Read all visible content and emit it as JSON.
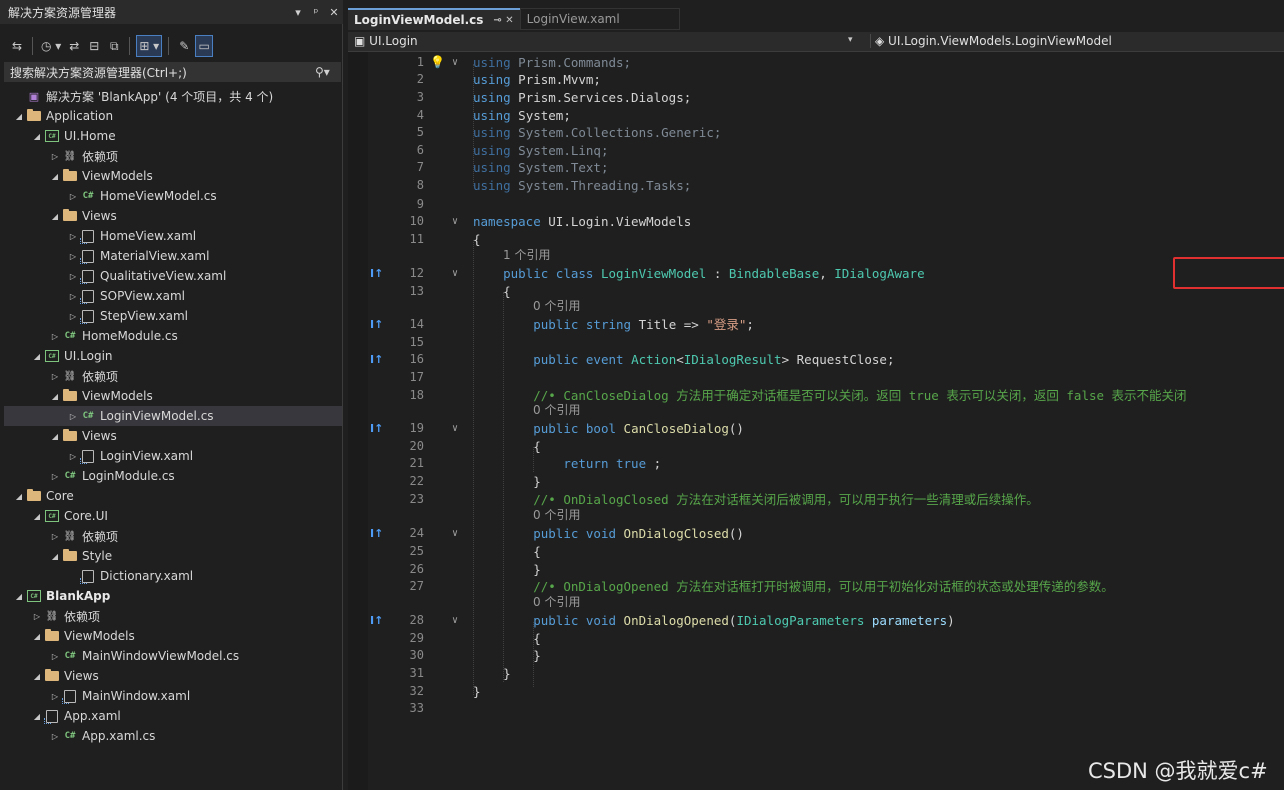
{
  "solution_explorer": {
    "title": "解决方案资源管理器",
    "title_buttons": [
      "▾",
      "ᵖ",
      "✕"
    ],
    "search_placeholder": "搜索解决方案资源管理器(Ctrl+;)",
    "tree": [
      {
        "indent": 0,
        "toggle": "",
        "icon": "sln",
        "label": "解决方案 'BlankApp' (4 个项目，共 4 个)"
      },
      {
        "indent": 0,
        "toggle": "◢",
        "icon": "folder",
        "label": "Application"
      },
      {
        "indent": 1,
        "toggle": "◢",
        "icon": "csproj",
        "label": "UI.Home"
      },
      {
        "indent": 2,
        "toggle": "▷",
        "icon": "dep",
        "label": "依赖项"
      },
      {
        "indent": 2,
        "toggle": "◢",
        "icon": "folder",
        "label": "ViewModels"
      },
      {
        "indent": 3,
        "toggle": "▷",
        "icon": "cs",
        "label": "HomeViewModel.cs"
      },
      {
        "indent": 2,
        "toggle": "◢",
        "icon": "folder",
        "label": "Views"
      },
      {
        "indent": 3,
        "toggle": "▷",
        "icon": "xaml",
        "label": "HomeView.xaml"
      },
      {
        "indent": 3,
        "toggle": "▷",
        "icon": "xaml",
        "label": "MaterialView.xaml"
      },
      {
        "indent": 3,
        "toggle": "▷",
        "icon": "xaml",
        "label": "QualitativeView.xaml"
      },
      {
        "indent": 3,
        "toggle": "▷",
        "icon": "xaml",
        "label": "SOPView.xaml"
      },
      {
        "indent": 3,
        "toggle": "▷",
        "icon": "xaml",
        "label": "StepView.xaml"
      },
      {
        "indent": 2,
        "toggle": "▷",
        "icon": "cs",
        "label": "HomeModule.cs"
      },
      {
        "indent": 1,
        "toggle": "◢",
        "icon": "csproj",
        "label": "UI.Login"
      },
      {
        "indent": 2,
        "toggle": "▷",
        "icon": "dep",
        "label": "依赖项"
      },
      {
        "indent": 2,
        "toggle": "◢",
        "icon": "folder",
        "label": "ViewModels"
      },
      {
        "indent": 3,
        "toggle": "▷",
        "icon": "cs",
        "label": "LoginViewModel.cs",
        "selected": true
      },
      {
        "indent": 2,
        "toggle": "◢",
        "icon": "folder",
        "label": "Views"
      },
      {
        "indent": 3,
        "toggle": "▷",
        "icon": "xaml",
        "label": "LoginView.xaml"
      },
      {
        "indent": 2,
        "toggle": "▷",
        "icon": "cs",
        "label": "LoginModule.cs"
      },
      {
        "indent": 0,
        "toggle": "◢",
        "icon": "folder",
        "label": "Core"
      },
      {
        "indent": 1,
        "toggle": "◢",
        "icon": "csproj",
        "label": "Core.UI"
      },
      {
        "indent": 2,
        "toggle": "▷",
        "icon": "dep",
        "label": "依赖项"
      },
      {
        "indent": 2,
        "toggle": "◢",
        "icon": "folder",
        "label": "Style"
      },
      {
        "indent": 3,
        "toggle": "",
        "icon": "xaml",
        "label": "Dictionary.xaml"
      },
      {
        "indent": 0,
        "toggle": "◢",
        "icon": "csproj",
        "label": "BlankApp",
        "bold": true
      },
      {
        "indent": 1,
        "toggle": "▷",
        "icon": "dep",
        "label": "依赖项"
      },
      {
        "indent": 1,
        "toggle": "◢",
        "icon": "folder",
        "label": "ViewModels"
      },
      {
        "indent": 2,
        "toggle": "▷",
        "icon": "cs",
        "label": "MainWindowViewModel.cs"
      },
      {
        "indent": 1,
        "toggle": "◢",
        "icon": "folder",
        "label": "Views"
      },
      {
        "indent": 2,
        "toggle": "▷",
        "icon": "xaml",
        "label": "MainWindow.xaml"
      },
      {
        "indent": 1,
        "toggle": "◢",
        "icon": "xaml",
        "label": "App.xaml"
      },
      {
        "indent": 2,
        "toggle": "▷",
        "icon": "cs",
        "label": "App.xaml.cs"
      }
    ]
  },
  "editor": {
    "tabs": [
      {
        "label": "LoginViewModel.cs",
        "active": true,
        "icons": "⊸ ✕"
      },
      {
        "label": "LoginView.xaml",
        "active": false,
        "icons": ""
      }
    ],
    "nav_left": "UI.Login",
    "nav_right": "UI.Login.ViewModels.LoginViewModel",
    "code_lines": [
      {
        "n": "1",
        "fold": "∨",
        "html": "<span class=\"kwd\">using</span> <span class=\"dim\">Prism.Commands;</span>"
      },
      {
        "n": "2",
        "html": "<span class=\"kw\">using</span> <span class=\"id\">Prism.Mvvm;</span>"
      },
      {
        "n": "3",
        "html": "<span class=\"kw\">using</span> <span class=\"id\">Prism.Services.Dialogs;</span>"
      },
      {
        "n": "4",
        "html": "<span class=\"kw\">using</span> <span class=\"id\">System;</span>"
      },
      {
        "n": "5",
        "html": "<span class=\"kwd\">using</span> <span class=\"dim\">System.Collections.Generic;</span>"
      },
      {
        "n": "6",
        "html": "<span class=\"kwd\">using</span> <span class=\"dim\">System.Linq;</span>"
      },
      {
        "n": "7",
        "html": "<span class=\"kwd\">using</span> <span class=\"dim\">System.Text;</span>"
      },
      {
        "n": "8",
        "html": "<span class=\"kwd\">using</span> <span class=\"dim\">System.Threading.Tasks;</span>"
      },
      {
        "n": "9",
        "html": ""
      },
      {
        "n": "10",
        "fold": "∨",
        "html": "<span class=\"kw\">namespace</span> <span class=\"ns\">UI.Login.ViewModels</span>"
      },
      {
        "n": "11",
        "html": "<span class=\"id\">{</span>"
      },
      {
        "n": "12",
        "fold": "∨",
        "impl": "I↑",
        "html": "    <span class=\"kw\">public class</span> <span class=\"ty\">LoginViewModel</span> <span class=\"id\">:</span> <span class=\"ty\">BindableBase</span><span class=\"id\">,</span> <span class=\"ty\">IDialogAware</span>"
      },
      {
        "n": "13",
        "html": "    <span class=\"id\">{</span>"
      },
      {
        "n": "14",
        "impl": "I↑",
        "html": "        <span class=\"kw\">public string</span> <span class=\"id\">Title =&gt;</span> <span class=\"st\">\"登录\"</span><span class=\"id\">;</span>"
      },
      {
        "n": "15",
        "html": ""
      },
      {
        "n": "16",
        "impl": "I↑",
        "html": "        <span class=\"kw\">public event</span> <span class=\"ty\">Action</span><span class=\"id\">&lt;</span><span class=\"ty\">IDialogResult</span><span class=\"id\">&gt; RequestClose;</span>"
      },
      {
        "n": "17",
        "html": ""
      },
      {
        "n": "18",
        "html": "        <span class=\"cm\">//• CanCloseDialog 方法用于确定对话框是否可以关闭。返回 true 表示可以关闭，返回 false 表示不能关闭</span>"
      },
      {
        "n": "19",
        "fold": "∨",
        "impl": "I↑",
        "html": "        <span class=\"kw\">public bool</span> <span class=\"mt\">CanCloseDialog</span><span class=\"id\">()</span>"
      },
      {
        "n": "20",
        "html": "        <span class=\"id\">{</span>"
      },
      {
        "n": "21",
        "html": "            <span class=\"kw\">return true</span> <span class=\"id\">;</span>"
      },
      {
        "n": "22",
        "html": "        <span class=\"id\">}</span>"
      },
      {
        "n": "23",
        "html": "        <span class=\"cm\">//• OnDialogClosed 方法在对话框关闭后被调用，可以用于执行一些清理或后续操作。</span>"
      },
      {
        "n": "24",
        "fold": "∨",
        "impl": "I↑",
        "html": "        <span class=\"kw\">public void</span> <span class=\"mt\">OnDialogClosed</span><span class=\"id\">()</span>"
      },
      {
        "n": "25",
        "html": "        <span class=\"id\">{</span>"
      },
      {
        "n": "26",
        "html": "        <span class=\"id\">}</span>"
      },
      {
        "n": "27",
        "html": "        <span class=\"cm\">//• OnDialogOpened 方法在对话框打开时被调用，可以用于初始化对话框的状态或处理传递的参数。</span>"
      },
      {
        "n": "28",
        "fold": "∨",
        "impl": "I↑",
        "html": "        <span class=\"kw\">public void</span> <span class=\"mt\">OnDialogOpened</span><span class=\"id\">(</span><span class=\"ty\">IDialogParameters</span> <span class=\"pm\">parameters</span><span class=\"id\">)</span>"
      },
      {
        "n": "29",
        "html": "        <span class=\"id\">{</span>"
      },
      {
        "n": "30",
        "html": "        <span class=\"id\">}</span>"
      },
      {
        "n": "31",
        "html": "    <span class=\"id\">}</span>"
      },
      {
        "n": "32",
        "html": "<span class=\"id\">}</span>"
      },
      {
        "n": "33",
        "html": ""
      }
    ],
    "ref_lenses": [
      {
        "before": "12",
        "text": "1 个引用",
        "indent": "    "
      },
      {
        "before": "14",
        "text": "0 个引用",
        "indent": "        "
      },
      {
        "before": "19",
        "text": "0 个引用",
        "indent": "        "
      },
      {
        "before": "24",
        "text": "0 个引用",
        "indent": "        "
      },
      {
        "before": "28",
        "text": "0 个引用",
        "indent": "        "
      }
    ]
  },
  "watermark": "CSDN @我就爱c#",
  "colors": {
    "highlight_box": "#e03030",
    "selection": "#37373d",
    "tab_accent": "#6c9fd6"
  }
}
